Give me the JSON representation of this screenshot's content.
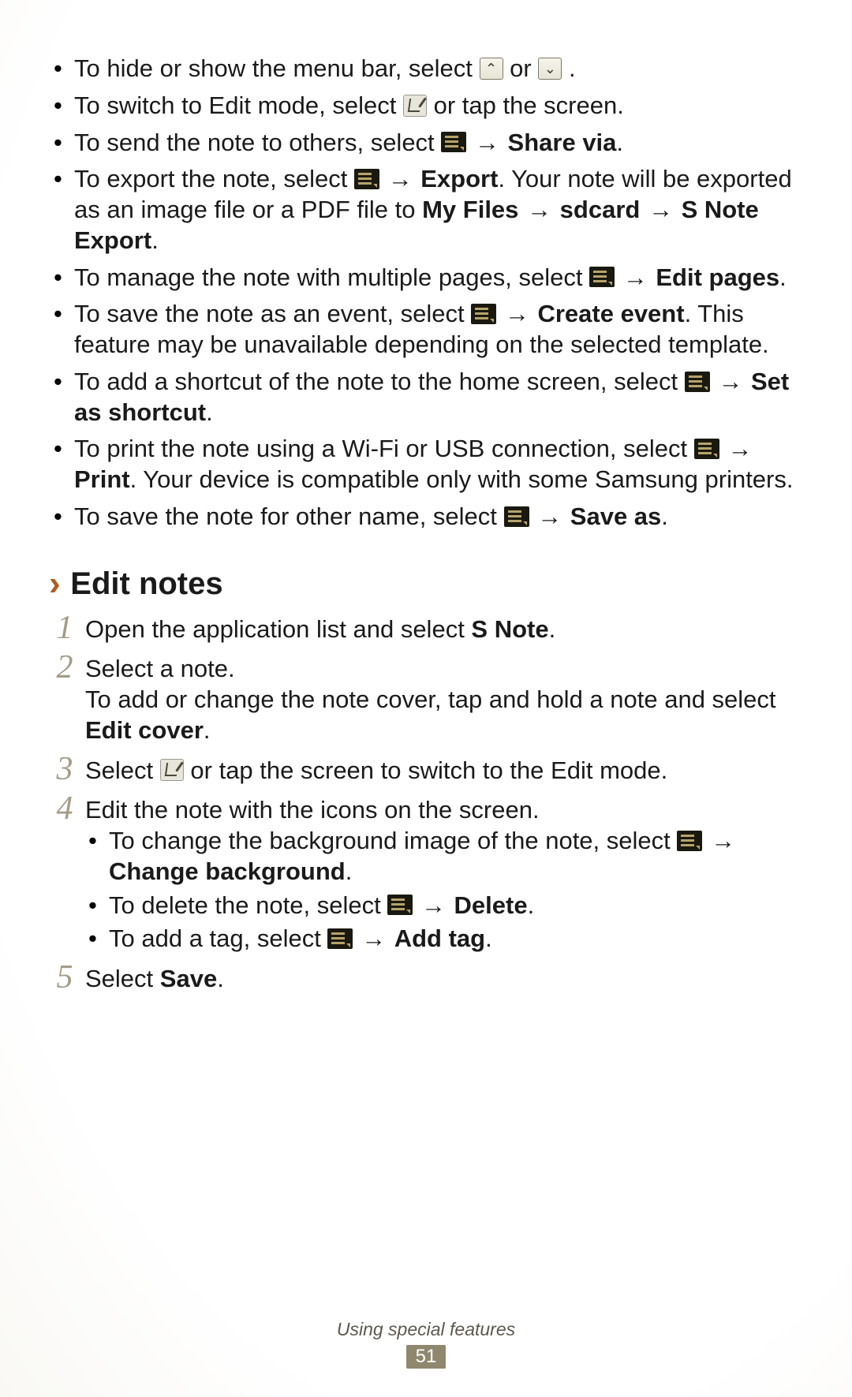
{
  "bullets": [
    {
      "pre": "To hide or show the menu bar, select ",
      "mid": " or ",
      "post": "."
    },
    {
      "pre": "To switch to Edit mode, select ",
      "post": " or tap the screen."
    },
    {
      "pre": "To send the note to others, select ",
      "arrow": " → ",
      "bold1": "Share via",
      "post": "."
    },
    {
      "pre": "To export the note, select ",
      "arrow": " → ",
      "bold1": "Export",
      "mid": ". Your note will be exported as an image file or a PDF file to ",
      "bold2": "My Files",
      "arrow2": " → ",
      "bold3": "sdcard",
      "arrow3": " → ",
      "bold4": "S Note Export",
      "post": "."
    },
    {
      "pre": "To manage the note with multiple pages, select ",
      "arrow": " → ",
      "bold1": "Edit pages",
      "post": "."
    },
    {
      "pre": "To save the note as an event, select ",
      "arrow": " → ",
      "bold1": "Create event",
      "post": ". This feature may be unavailable depending on the selected template."
    },
    {
      "pre": "To add a shortcut of the note to the home screen, select ",
      "arrow": " → ",
      "bold1": "Set as shortcut",
      "post": "."
    },
    {
      "pre": "To print the note using a Wi-Fi or USB connection, select ",
      "arrow": " → ",
      "bold1": "Print",
      "post": ". Your device is compatible only with some Samsung printers."
    },
    {
      "pre": "To save the note for other name, select ",
      "arrow": " → ",
      "bold1": "Save as",
      "post": "."
    }
  ],
  "heading": {
    "chevron": "›",
    "text": "Edit notes"
  },
  "steps": {
    "s1": {
      "num": "1",
      "pre": "Open the application list and select ",
      "bold": "S Note",
      "post": "."
    },
    "s2": {
      "num": "2",
      "line1": "Select a note.",
      "line2a": "To add or change the note cover, tap and hold a note and select ",
      "bold": "Edit cover",
      "line2b": "."
    },
    "s3": {
      "num": "3",
      "pre": "Select ",
      "post": " or tap the screen to switch to the Edit mode."
    },
    "s4": {
      "num": "4",
      "line1": "Edit the note with the icons on the screen.",
      "sub1": {
        "pre": "To change the background image of the note, select ",
        "arrow": " → ",
        "bold": "Change background",
        "post": "."
      },
      "sub2": {
        "pre": "To delete the note, select ",
        "arrow": " → ",
        "bold": "Delete",
        "post": "."
      },
      "sub3": {
        "pre": "To add a tag, select ",
        "arrow": " → ",
        "bold": "Add tag",
        "post": "."
      }
    },
    "s5": {
      "num": "5",
      "pre": "Select ",
      "bold": "Save",
      "post": "."
    }
  },
  "footer": {
    "label": "Using special features",
    "page": "51"
  }
}
